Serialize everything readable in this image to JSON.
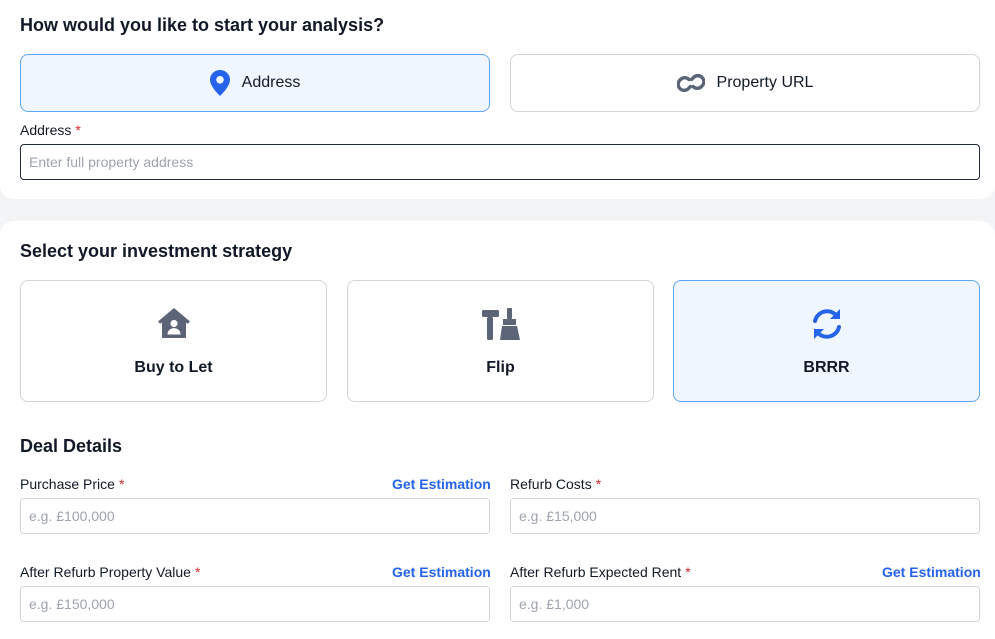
{
  "start": {
    "title": "How would you like to start your analysis?",
    "options": [
      {
        "label": "Address",
        "icon": "map-pin-icon",
        "selected": true
      },
      {
        "label": "Property URL",
        "icon": "link-icon",
        "selected": false
      }
    ],
    "address": {
      "label": "Address",
      "required_mark": "*",
      "placeholder": "Enter full property address",
      "value": ""
    }
  },
  "strategy": {
    "title": "Select your investment strategy",
    "options": [
      {
        "label": "Buy to Let",
        "icon": "house-user-icon",
        "selected": false
      },
      {
        "label": "Flip",
        "icon": "tools-icon",
        "selected": false
      },
      {
        "label": "BRRR",
        "icon": "refresh-icon",
        "selected": true
      }
    ]
  },
  "deal": {
    "title": "Deal Details",
    "estimate_label": "Get Estimation",
    "fields": [
      {
        "label": "Purchase Price",
        "required_mark": "*",
        "placeholder": "e.g. £100,000",
        "value": "",
        "has_estimate": true
      },
      {
        "label": "Refurb Costs",
        "required_mark": "*",
        "placeholder": "e.g. £15,000",
        "value": "",
        "has_estimate": false
      },
      {
        "label": "After Refurb Property Value",
        "required_mark": "*",
        "placeholder": "e.g. £150,000",
        "value": "",
        "has_estimate": true
      },
      {
        "label": "After Refurb Expected Rent",
        "required_mark": "*",
        "placeholder": "e.g. £1,000",
        "value": "",
        "has_estimate": true
      }
    ]
  },
  "colors": {
    "accent": "#2563eb",
    "selected_bg": "#eff6ff",
    "selected_border": "#60a5fa",
    "required": "#dc2626",
    "icon_gray": "#5b6577"
  }
}
